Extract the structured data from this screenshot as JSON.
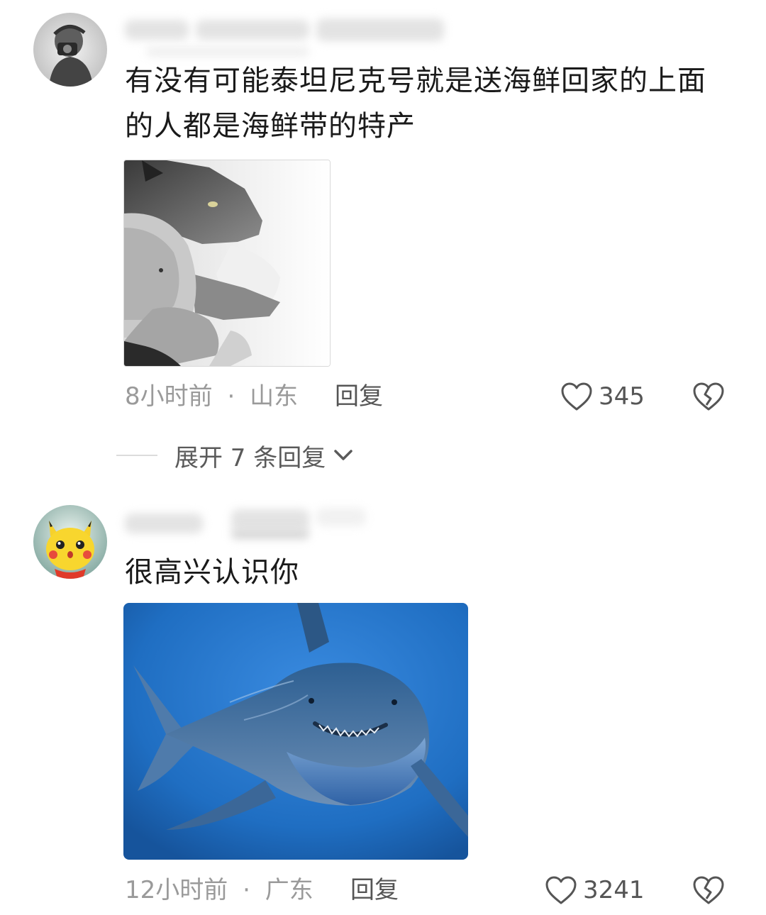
{
  "comments": [
    {
      "text": "有没有可能泰坦尼克号就是送海鲜回家的上面的人都是海鲜带的特产",
      "time": "8小时前",
      "location": "山东",
      "separator": "·",
      "reply_label": "回复",
      "likes": "345",
      "expand_replies": "展开 7 条回复"
    },
    {
      "text": "很高兴认识你",
      "time": "12小时前",
      "location": "广东",
      "separator": "·",
      "reply_label": "回复",
      "likes": "3241"
    }
  ],
  "icons": {
    "like": "heart-outline-icon",
    "dislike": "broken-heart-icon",
    "expand": "chevron-down-icon"
  },
  "colors": {
    "meta_text": "#9a9a9a",
    "action_text": "#555555",
    "body_text": "#1a1a1a",
    "shark_water": "#1f6ec2"
  }
}
